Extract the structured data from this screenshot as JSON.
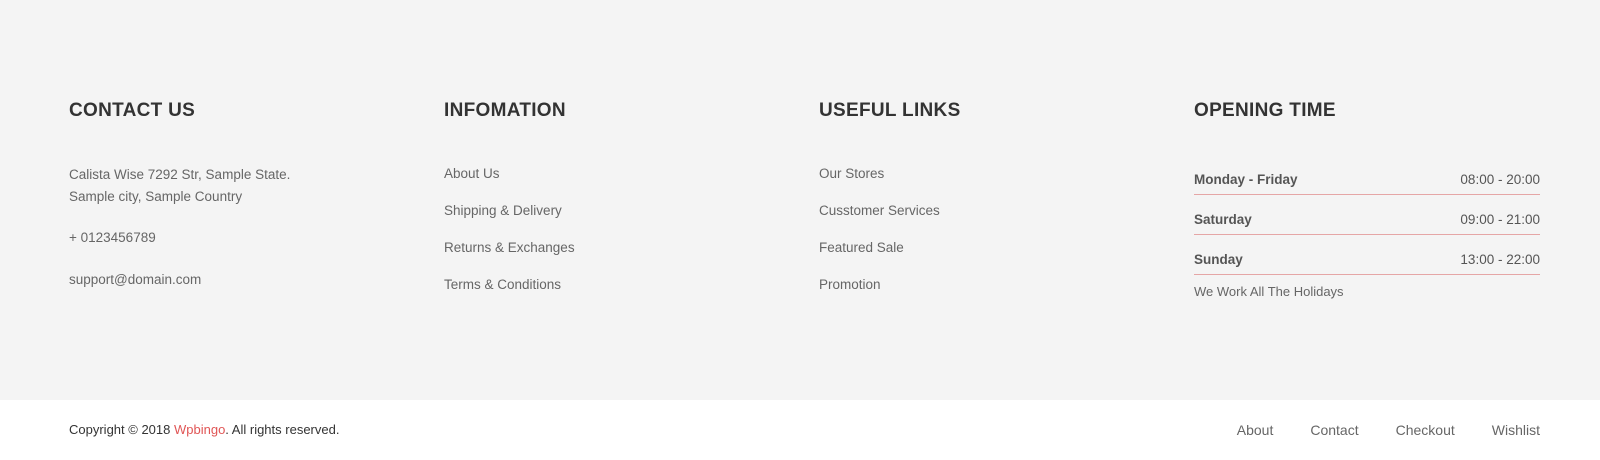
{
  "contact": {
    "title": "CONTACT US",
    "address_line1": "Calista Wise 7292 Str, Sample State.",
    "address_line2": "Sample city, Sample Country",
    "phone": "+ 0123456789",
    "email": "support@domain.com"
  },
  "information": {
    "title": "INFOMATION",
    "links": [
      "About Us",
      "Shipping & Delivery",
      "Returns & Exchanges",
      "Terms & Conditions"
    ]
  },
  "useful_links": {
    "title": "USEFUL LINKS",
    "links": [
      "Our Stores",
      "Cusstomer Services",
      "Featured Sale",
      "Promotion"
    ]
  },
  "opening_time": {
    "title": "OPENING TIME",
    "rows": [
      {
        "day": "Monday - Friday",
        "hours": "08:00 - 20:00"
      },
      {
        "day": "Saturday",
        "hours": "09:00 - 21:00"
      },
      {
        "day": "Sunday",
        "hours": "13:00 - 22:00"
      }
    ],
    "note": "We Work All The Holidays"
  },
  "bottom": {
    "copyright_prefix": "Copyright © 2018 ",
    "brand": "Wpbingo",
    "copyright_suffix": ". All rights reserved.",
    "nav": [
      "About",
      "Contact",
      "Checkout",
      "Wishlist"
    ]
  },
  "colors": {
    "accent": "#e05555",
    "background_top": "#f4f4f4",
    "divider": "#e5a6a6"
  }
}
